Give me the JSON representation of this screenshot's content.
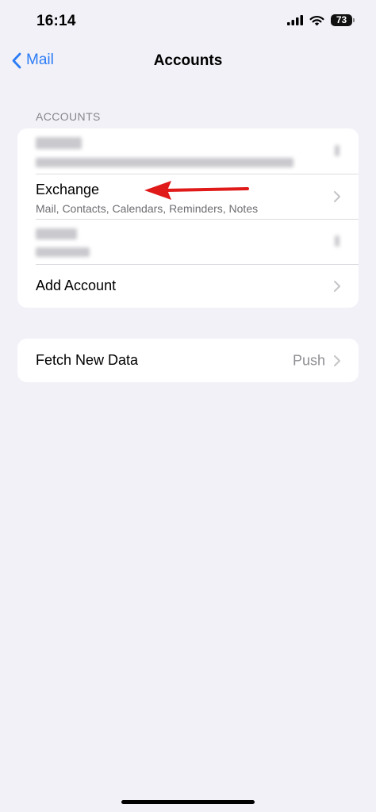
{
  "status_bar": {
    "time": "16:14",
    "battery": "73"
  },
  "nav": {
    "back_label": "Mail",
    "title": "Accounts"
  },
  "accounts_section": {
    "header": "ACCOUNTS",
    "rows": [
      {
        "title": "",
        "subtitle": ""
      },
      {
        "title": "Exchange",
        "subtitle": "Mail, Contacts, Calendars, Reminders, Notes"
      },
      {
        "title": "",
        "subtitle": ""
      }
    ],
    "add_account_label": "Add Account"
  },
  "fetch_section": {
    "label": "Fetch New Data",
    "value": "Push"
  },
  "colors": {
    "accent": "#2b7cf6",
    "annotation_arrow": "#e01919",
    "background": "#f2f1f7"
  }
}
